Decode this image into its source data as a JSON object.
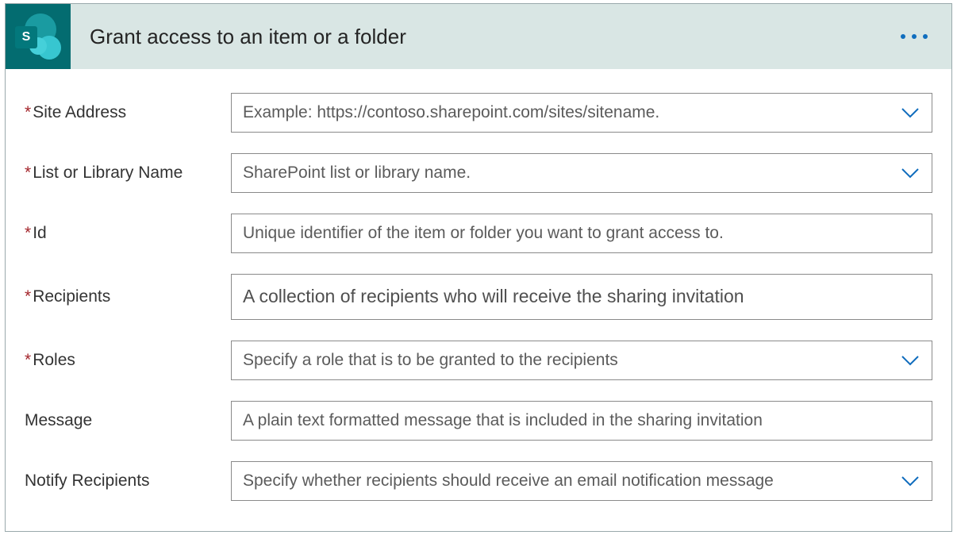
{
  "header": {
    "title": "Grant access to an item or a folder",
    "icon_letter": "S",
    "icon_name": "sharepoint-icon"
  },
  "fields": {
    "site_address": {
      "label": "Site Address",
      "required": true,
      "placeholder": "Example: https://contoso.sharepoint.com/sites/sitename.",
      "has_dropdown": true
    },
    "list_or_library": {
      "label": "List or Library Name",
      "required": true,
      "placeholder": "SharePoint list or library name.",
      "has_dropdown": true
    },
    "id": {
      "label": "Id",
      "required": true,
      "placeholder": "Unique identifier of the item or folder you want to grant access to.",
      "has_dropdown": false
    },
    "recipients": {
      "label": "Recipients",
      "required": true,
      "placeholder": "A collection of recipients who will receive the sharing invitation",
      "has_dropdown": false
    },
    "roles": {
      "label": "Roles",
      "required": true,
      "placeholder": "Specify a role that is to be granted to the recipients",
      "has_dropdown": true
    },
    "message": {
      "label": "Message",
      "required": false,
      "placeholder": "A plain text formatted message that is included in the sharing invitation",
      "has_dropdown": false
    },
    "notify": {
      "label": "Notify Recipients",
      "required": false,
      "placeholder": "Specify whether recipients should receive an email notification message",
      "has_dropdown": true
    }
  }
}
